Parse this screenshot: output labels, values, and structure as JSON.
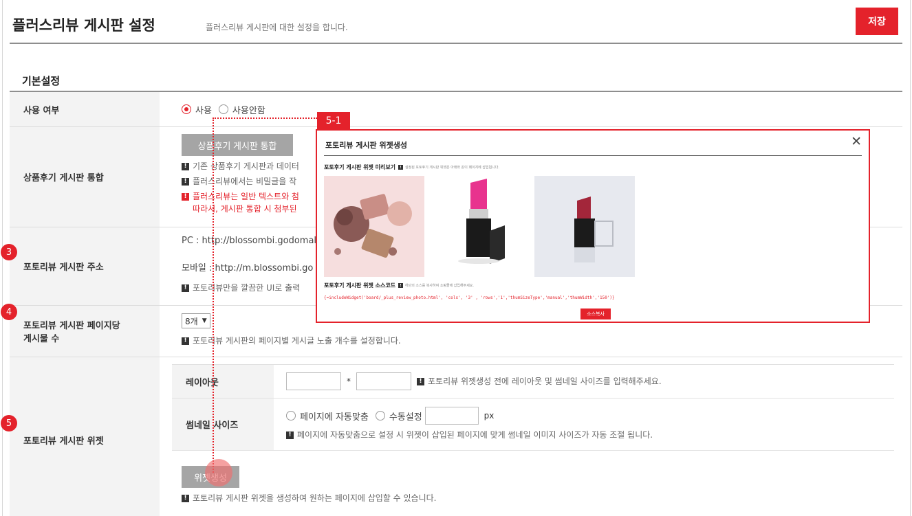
{
  "header": {
    "title": "플러스리뷰 게시판 설정",
    "subtitle": "플러스리뷰 게시판에 대한 설정을 합니다.",
    "save_label": "저장"
  },
  "section": {
    "title": "기본설정"
  },
  "rows": {
    "usage": {
      "label": "사용 여부",
      "options": [
        {
          "label": "사용",
          "checked": true
        },
        {
          "label": "사용안함",
          "checked": false
        }
      ]
    },
    "merge": {
      "label": "상품후기 게시판 통합",
      "button": "상품후기 게시판 통합",
      "notes": [
        "기존 상품후기 게시판과 데이터",
        "플러스리뷰에서는 비밀글을 작",
        "플러스리뷰는 일반 텍스트와 첨",
        "따라서, 게시판 통합 시 첨부된"
      ]
    },
    "address": {
      "label": "포토리뷰 게시판 주소",
      "pc": "PC : http://blossombi.godomall",
      "mobile": "모바일 : http://m.blossombi.go",
      "note": "포토리뷰만을 깔끔한 UI로 출력"
    },
    "perpage": {
      "label_line1": "포토리뷰 게시판 페이지당",
      "label_line2": "게시물 수",
      "select_value": "8개",
      "note": "포토리뷰 게시판의 페이지별 게시글 노출 개수를 설정합니다."
    },
    "widget": {
      "label": "포토리뷰 게시판 위젯",
      "layout_label": "레이아웃",
      "layout_sep": "*",
      "layout_note": "포토리뷰 위젯생성 전에 레이아웃 및 썸네일 사이즈를 입력해주세요.",
      "thumb_label": "썸네일 사이즈",
      "thumb_options": [
        {
          "label": "페이지에 자동맞춤",
          "checked": false
        },
        {
          "label": "수동설정",
          "checked": false
        }
      ],
      "thumb_unit": "px",
      "thumb_note": "페이지에 자동맞춤으로 설정 시 위젯이 삽입된 페이지에 맞게 썸네일 이미지 사이즈가 자동 조절 됩니다.",
      "create_button": "위젯생성",
      "create_note": "포토리뷰 게시판 위젯을 생성하여 원하는 페이지에 삽입할 수 있습니다."
    }
  },
  "badges": [
    "3",
    "4",
    "5"
  ],
  "popup": {
    "tag": "5-1",
    "title": "포토리뷰 게시판 위젯생성",
    "preview_title": "포토후기 게시판 위젯 미리보기",
    "preview_desc": "설정된 포토후기 게시판 위젯은 아래와 같이 페이지에 삽입됩니다.",
    "source_title": "포토후기 게시판 위젯 소스코드",
    "source_desc": "하단의 소스를 복사하여 쇼핑몰에 삽입해주세요.",
    "code": "{=includeWidget('board/_plus_review_photo.html', 'cols', '3' , 'rows','1','thumSizeType','manual','thumWidth','150')}",
    "copy_button": "소스복사"
  }
}
